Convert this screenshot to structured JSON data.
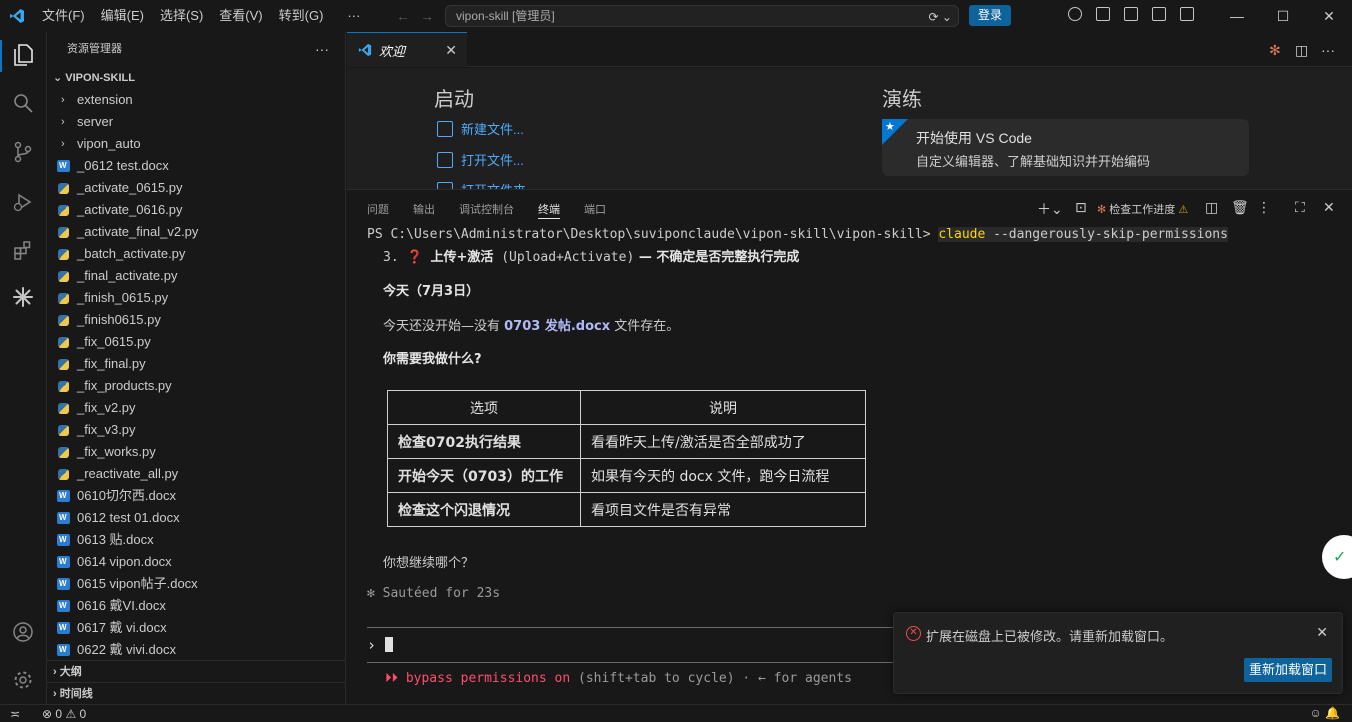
{
  "menu": [
    "文件(F)",
    "编辑(E)",
    "选择(S)",
    "查看(V)",
    "转到(G)",
    "···"
  ],
  "command_center": {
    "title": "vipon-skill [管理员]"
  },
  "login_label": "登录",
  "window_controls": {
    "minimize": "—",
    "maximize": "☐",
    "close": "✕"
  },
  "sidebar": {
    "header": "资源管理器",
    "root": "VIPON-SKILL",
    "folders": [
      "extension",
      "server",
      "vipon_auto"
    ],
    "files": [
      {
        "name": "_0612 test.docx",
        "type": "word"
      },
      {
        "name": "_activate_0615.py",
        "type": "py"
      },
      {
        "name": "_activate_0616.py",
        "type": "py"
      },
      {
        "name": "_activate_final_v2.py",
        "type": "py"
      },
      {
        "name": "_batch_activate.py",
        "type": "py"
      },
      {
        "name": "_final_activate.py",
        "type": "py"
      },
      {
        "name": "_finish_0615.py",
        "type": "py"
      },
      {
        "name": "_finish0615.py",
        "type": "py"
      },
      {
        "name": "_fix_0615.py",
        "type": "py"
      },
      {
        "name": "_fix_final.py",
        "type": "py"
      },
      {
        "name": "_fix_products.py",
        "type": "py"
      },
      {
        "name": "_fix_v2.py",
        "type": "py"
      },
      {
        "name": "_fix_v3.py",
        "type": "py"
      },
      {
        "name": "_fix_works.py",
        "type": "py"
      },
      {
        "name": "_reactivate_all.py",
        "type": "py"
      },
      {
        "name": "0610切尔西.docx",
        "type": "word"
      },
      {
        "name": "0612 test 01.docx",
        "type": "word"
      },
      {
        "name": "0613 贴.docx",
        "type": "word"
      },
      {
        "name": "0614 vipon.docx",
        "type": "word"
      },
      {
        "name": "0615 vipon帖子.docx",
        "type": "word"
      },
      {
        "name": "0616 戴VI.docx",
        "type": "word"
      },
      {
        "name": "0617 戴 vi.docx",
        "type": "word"
      },
      {
        "name": "0622 戴 vivi.docx",
        "type": "word"
      }
    ],
    "outline": "大纲",
    "timeline": "时间线"
  },
  "editor_tab": {
    "label": "欢迎"
  },
  "welcome": {
    "start_heading": "启动",
    "links": [
      "新建文件...",
      "打开文件...",
      "打开文件夹..."
    ],
    "walkthrough_heading": "演练",
    "card_title": "开始使用 VS Code",
    "card_desc": "自定义编辑器、了解基础知识并开始编码"
  },
  "panel": {
    "tabs": [
      "问题",
      "输出",
      "调试控制台",
      "终端",
      "端口"
    ],
    "active_tab": "终端",
    "check_progress": "检查工作进度"
  },
  "terminal": {
    "prompt": "PS C:\\Users\\Administrator\\Desktop\\suviponclaude\\vipon-skill\\vipon-skill> ",
    "cmd": "claude",
    "cmd_args": " --dangerously-skip-permissions",
    "item3_num": "3. ",
    "item3_mark": "❓",
    "item3_title": "上传+激活",
    "item3_en": " (Upload+Activate)",
    "item3_rest": " — 不确定是否完整执行完成",
    "today_heading": "今天（7月3日）",
    "today_pre": "今天还没开始—没有 ",
    "today_code": "0703 发帖.docx",
    "today_post": " 文件存在。",
    "question": "你需要我做什么?",
    "table_headers": [
      "选项",
      "说明"
    ],
    "table_rows": [
      [
        "检查0702执行结果",
        "看看昨天上传/激活是否全部成功了"
      ],
      [
        "开始今天（0703）的工作",
        "如果有今天的 docx 文件，跑今日流程"
      ],
      [
        "检查这个闪退情况",
        "看项目文件是否有异常"
      ]
    ],
    "continue_q": "你想继续哪个？",
    "sauteed": "✻ Sautéed for 23s",
    "input_caret": "›",
    "bypass_marker": "⏵⏵ bypass permissions on",
    "bypass_rest": " (shift+tab to cycle) · ← for agents"
  },
  "notification": {
    "message": "扩展在磁盘上已被修改。请重新加载窗口。",
    "button": "重新加载窗口"
  },
  "status": {
    "errors": "0",
    "warnings": "0"
  }
}
